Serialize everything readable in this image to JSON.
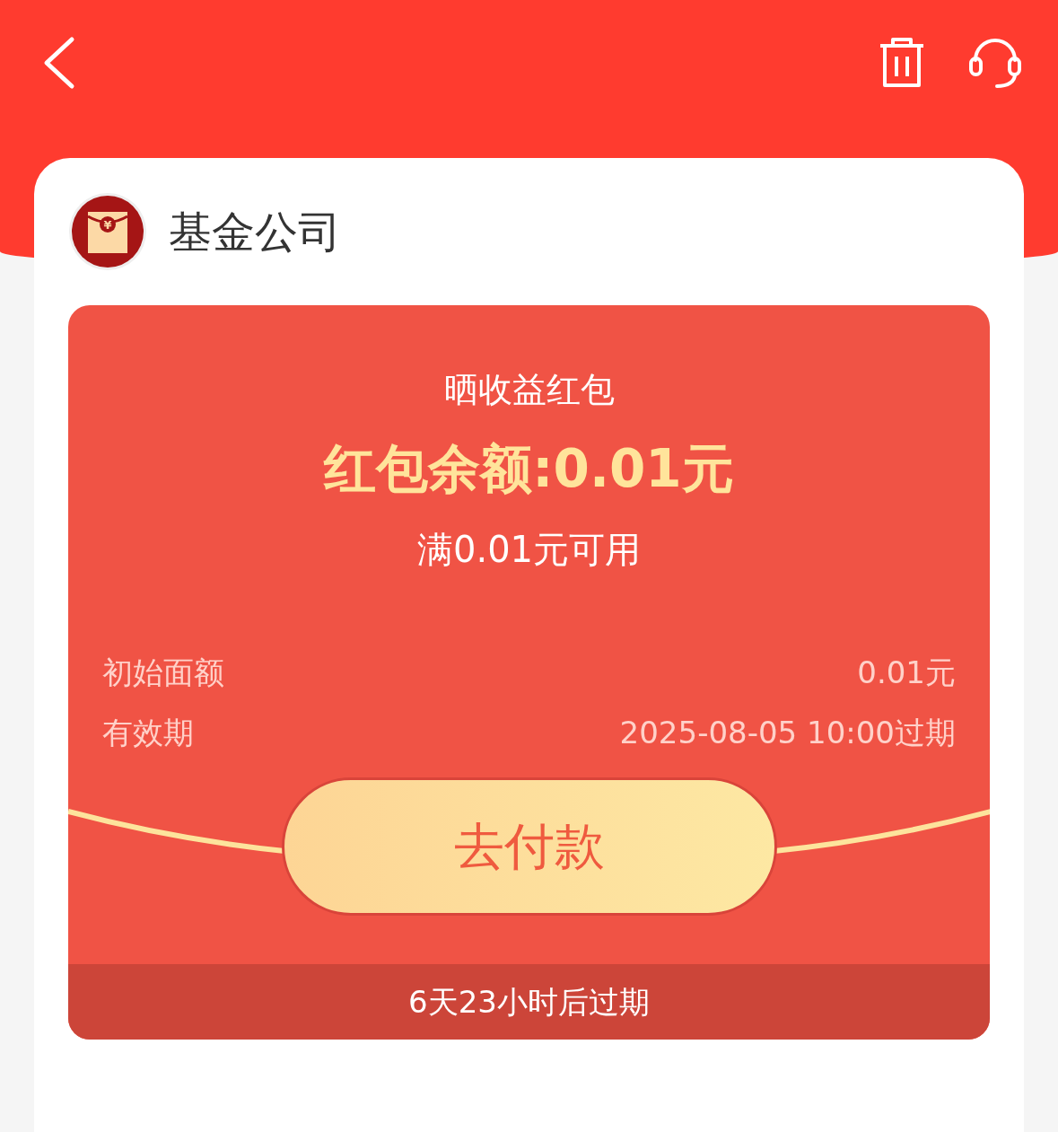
{
  "header": {
    "actions": [
      {
        "kind": "trash"
      },
      {
        "kind": "headset"
      }
    ]
  },
  "issuer": {
    "name": "基金公司",
    "logo_mark": "¥"
  },
  "coupon": {
    "title": "晒收益红包",
    "balance": "红包余额:0.01元",
    "condition": "满0.01元可用",
    "details": [
      {
        "label": "初始面额",
        "value": "0.01元"
      },
      {
        "label": "有效期",
        "value": "2025-08-05 10:00过期"
      }
    ],
    "button": "去付款",
    "footer": "6天23小时后过期"
  }
}
